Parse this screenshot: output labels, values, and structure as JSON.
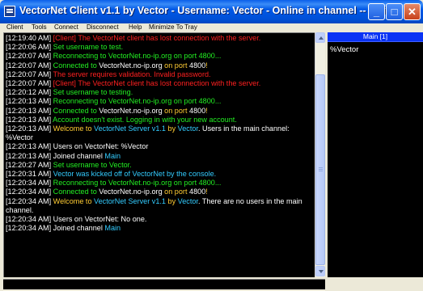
{
  "window": {
    "title": "VectorNet Client v1.1 by Vector - Username: Vector - Online in channel -- Main",
    "buttons": {
      "minimize": "_",
      "maximize": "□",
      "close": "✕"
    }
  },
  "menu": [
    "Client",
    "Tools",
    "Connect",
    "Disconnect",
    "Help",
    "Minimize To Tray"
  ],
  "colors": {
    "white": "#FFFFFF",
    "red": "#FF2020",
    "green": "#22EE22",
    "orange": "#FFCC33",
    "cyan": "#33CCFF",
    "header": "#0A33F5"
  },
  "chat": {
    "lines": [
      [
        [
          "[12:19:40 AM] ",
          "white"
        ],
        [
          "[Client] The VectorNet client has lost connection with the server.",
          "red"
        ]
      ],
      [
        [
          "[12:20:06 AM] ",
          "white"
        ],
        [
          "Set username to test.",
          "green"
        ]
      ],
      [
        [
          "[12:20:07 AM] ",
          "white"
        ],
        [
          "Reconnecting to VectorNet.no-ip.org on port 4800...",
          "green"
        ]
      ],
      [
        [
          "[12:20:07 AM] ",
          "white"
        ],
        [
          "Connected to ",
          "green"
        ],
        [
          "VectorNet.no-ip.org",
          "white"
        ],
        [
          " on port ",
          "orange"
        ],
        [
          "4800",
          "white"
        ],
        [
          "!",
          "orange"
        ]
      ],
      [
        [
          "[12:20:07 AM] ",
          "white"
        ],
        [
          "The server requires validation. Invalid password.",
          "red"
        ]
      ],
      [
        [
          "[12:20:07 AM] ",
          "white"
        ],
        [
          "[Client] The VectorNet client has lost connection with the server.",
          "red"
        ]
      ],
      [
        [
          "[12:20:12 AM] ",
          "white"
        ],
        [
          "Set username to testing.",
          "green"
        ]
      ],
      [
        [
          "[12:20:13 AM] ",
          "white"
        ],
        [
          "Reconnecting to VectorNet.no-ip.org on port 4800...",
          "green"
        ]
      ],
      [
        [
          "[12:20:13 AM] ",
          "white"
        ],
        [
          "Connected to ",
          "green"
        ],
        [
          "VectorNet.no-ip.org",
          "white"
        ],
        [
          " on port ",
          "orange"
        ],
        [
          "4800",
          "white"
        ],
        [
          "!",
          "orange"
        ]
      ],
      [
        [
          "[12:20:13 AM] ",
          "white"
        ],
        [
          "Account doesn't exist. Logging in with your new account.",
          "green"
        ]
      ],
      [
        [
          "[12:20:13 AM] ",
          "white"
        ],
        [
          "Welcome to ",
          "orange"
        ],
        [
          "VectorNet Server v1.1",
          "cyan"
        ],
        [
          " by ",
          "orange"
        ],
        [
          "Vector",
          "cyan"
        ],
        [
          ". Users in the main channel: %Vector",
          "white"
        ]
      ],
      [
        [
          "[12:20:13 AM] ",
          "white"
        ],
        [
          "Users on VectorNet: %Vector",
          "white"
        ]
      ],
      [
        [
          "[12:20:13 AM] ",
          "white"
        ],
        [
          "Joined channel ",
          "white"
        ],
        [
          "Main",
          "cyan"
        ]
      ],
      [
        [
          "[12:20:27 AM] ",
          "white"
        ],
        [
          "Set username to Vector.",
          "green"
        ]
      ],
      [
        [
          "[12:20:31 AM] ",
          "white"
        ],
        [
          "Vector was kicked off of VectorNet by the console.",
          "cyan"
        ]
      ],
      [
        [
          "[12:20:34 AM] ",
          "white"
        ],
        [
          "Reconnecting to VectorNet.no-ip.org on port 4800...",
          "green"
        ]
      ],
      [
        [
          "[12:20:34 AM] ",
          "white"
        ],
        [
          "Connected to ",
          "green"
        ],
        [
          "VectorNet.no-ip.org",
          "white"
        ],
        [
          " on port ",
          "orange"
        ],
        [
          "4800",
          "white"
        ],
        [
          "!",
          "orange"
        ]
      ],
      [
        [
          "[12:20:34 AM] ",
          "white"
        ],
        [
          "Welcome to ",
          "orange"
        ],
        [
          "VectorNet Server v1.1",
          "cyan"
        ],
        [
          " by ",
          "orange"
        ],
        [
          "Vector",
          "cyan"
        ],
        [
          ". There are no users in the main channel.",
          "white"
        ]
      ],
      [
        [
          "[12:20:34 AM] ",
          "white"
        ],
        [
          "Users on VectorNet: No one.",
          "white"
        ]
      ],
      [
        [
          "[12:20:34 AM] ",
          "white"
        ],
        [
          "Joined channel ",
          "white"
        ],
        [
          "Main",
          "cyan"
        ]
      ]
    ]
  },
  "users_panel": {
    "header": "Main [1]",
    "users": [
      "%Vector"
    ]
  },
  "input": {
    "value": ""
  }
}
